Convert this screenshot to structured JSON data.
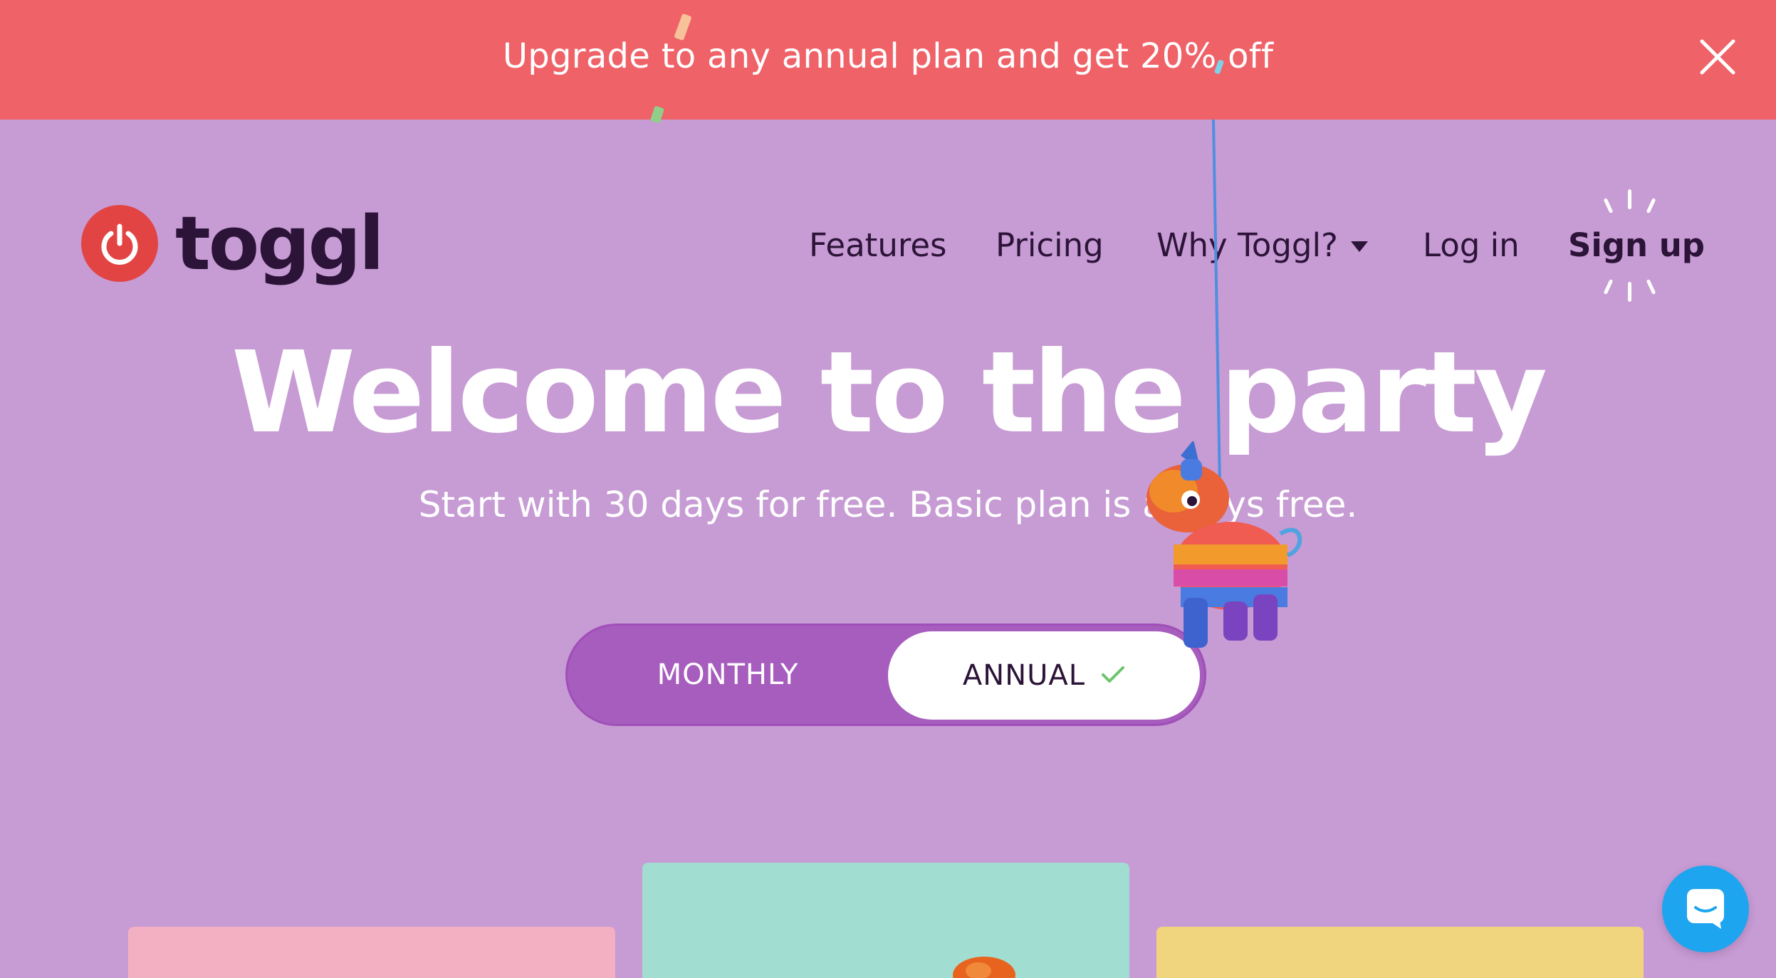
{
  "banner": {
    "text": "Upgrade to any annual plan and get 20% off",
    "close_icon": "close-icon",
    "background": "#ef6268"
  },
  "brand": {
    "name": "toggl",
    "logo_icon": "power-icon",
    "color": "#e24443"
  },
  "nav": {
    "features": "Features",
    "pricing": "Pricing",
    "why": "Why Toggl?",
    "login": "Log in",
    "signup": "Sign up"
  },
  "hero": {
    "title": "Welcome to the party",
    "subtitle": "Start with 30 days for free. Basic plan is always free.",
    "background": "#c79bd4"
  },
  "billing_toggle": {
    "monthly_label": "MONTHLY",
    "annual_label": "ANNUAL",
    "selected": "ANNUAL",
    "check_icon": "check-icon",
    "accent": "#a65dbd"
  },
  "cards": {
    "colors": [
      "#f4b0c3",
      "#a1ddd1",
      "#f0d47e"
    ]
  },
  "chat": {
    "icon": "chat-icon",
    "color": "#1ea5ef"
  }
}
